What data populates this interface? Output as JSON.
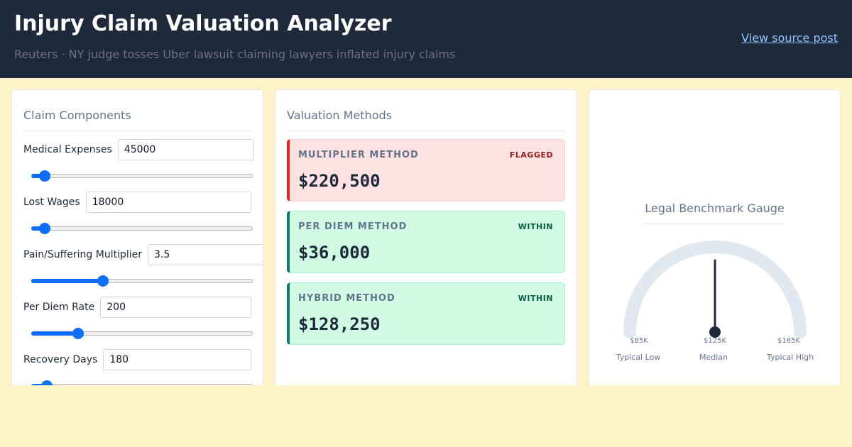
{
  "header": {
    "title": "Injury Claim Valuation Analyzer",
    "subtitle": "Reuters · NY judge tosses Uber lawsuit claiming lawyers inflated injury claims",
    "source_link": "View source post"
  },
  "components": {
    "title": "Claim Components",
    "fields": [
      {
        "label": "Medical Expenses",
        "value": "45000",
        "slider_fraction": 0.06
      },
      {
        "label": "Lost Wages",
        "value": "18000",
        "slider_fraction": 0.06
      },
      {
        "label": "Pain/Suffering Multiplier",
        "value": "3.5",
        "slider_fraction": 0.325
      },
      {
        "label": "Per Diem Rate",
        "value": "200",
        "slider_fraction": 0.21
      },
      {
        "label": "Recovery Days",
        "value": "180",
        "slider_fraction": 0.07
      }
    ]
  },
  "valuation": {
    "title": "Valuation Methods",
    "methods": [
      {
        "name": "MULTIPLIER METHOD",
        "status": "FLAGGED",
        "value": "$220,500"
      },
      {
        "name": "PER DIEM METHOD",
        "status": "WITHIN",
        "value": "$36,000"
      },
      {
        "name": "HYBRID METHOD",
        "status": "WITHIN",
        "value": "$128,250"
      }
    ]
  },
  "gauge": {
    "title": "Legal Benchmark Gauge",
    "needle_value_k": 125,
    "range_k": [
      85,
      165
    ],
    "ticks": [
      {
        "value": "$85K",
        "label": "Typical Low"
      },
      {
        "value": "$125K",
        "label": "Median"
      },
      {
        "value": "$165K",
        "label": "Typical High"
      }
    ],
    "colors": {
      "arc": "#e2e8f0",
      "needle": "#1e293b"
    }
  }
}
